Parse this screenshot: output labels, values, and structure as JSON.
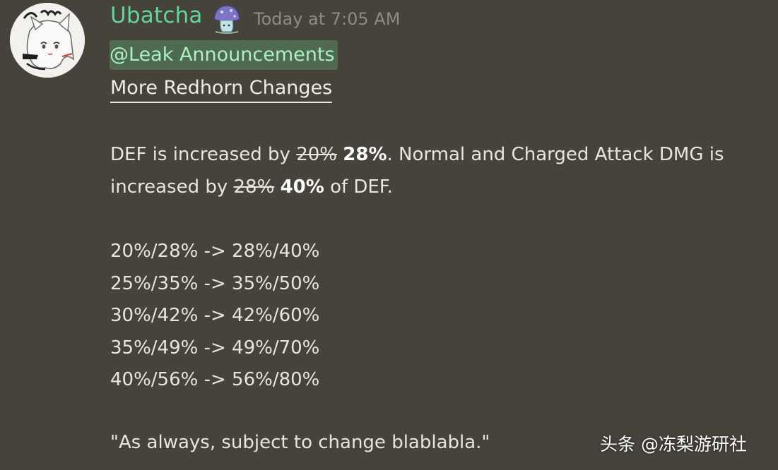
{
  "message": {
    "username": "Ubatcha",
    "timestamp": "Today at 7:05 AM",
    "mention": "@Leak Announcements",
    "heading": "More Redhorn Changes",
    "paragraph": {
      "t1": "DEF is increased by ",
      "old1": "20%",
      "new1": "28%",
      "t2": ". Normal and Charged Attack DMG is increased by ",
      "old2": "28%",
      "new2": "40%",
      "t3": " of DEF."
    },
    "changes": [
      "20%/28% -> 28%/40%",
      "25%/35% -> 35%/50%",
      "30%/42% -> 42%/60%",
      "35%/49% -> 49%/70%",
      "40%/56% -> 56%/80%"
    ],
    "quote": "\"As always, subject to change blablabla.\""
  },
  "watermark": "头条 @冻梨游研社",
  "icons": {
    "avatar": "anime-avatar",
    "badge": "mushroom-badge-icon"
  },
  "colors": {
    "background": "#46433b",
    "username": "#5fd79b",
    "mention_bg": "#4f6a4f",
    "mention_text": "#a9f0c2",
    "timestamp": "#8e8b84"
  }
}
